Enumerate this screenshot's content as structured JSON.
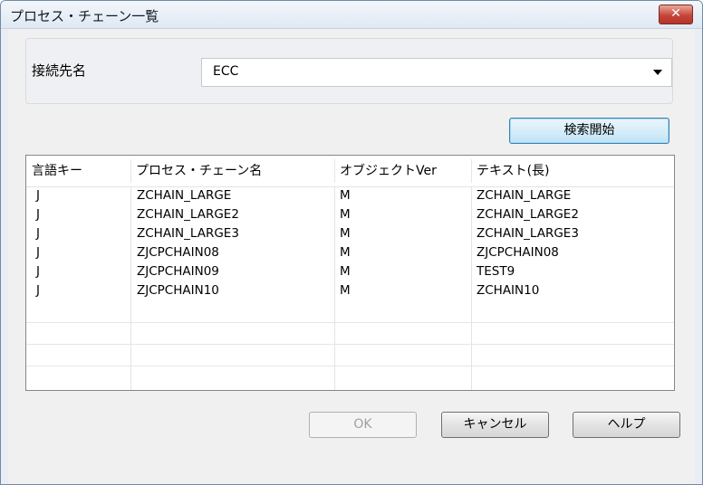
{
  "window": {
    "title": "プロセス・チェーン一覧",
    "close_label": "✕"
  },
  "connection": {
    "label": "接続先名",
    "value": "ECC"
  },
  "search_button": "検索開始",
  "table": {
    "columns": [
      "言語キー",
      "プロセス・チェーン名",
      "オブジェクトVer",
      "テキスト(長)"
    ],
    "rows": [
      [
        "J",
        "ZCHAIN_LARGE",
        "M",
        "ZCHAIN_LARGE"
      ],
      [
        "J",
        "ZCHAIN_LARGE2",
        "M",
        "ZCHAIN_LARGE2"
      ],
      [
        "J",
        "ZCHAIN_LARGE3",
        "M",
        "ZCHAIN_LARGE3"
      ],
      [
        "J",
        "ZJCPCHAIN08",
        "M",
        "ZJCPCHAIN08"
      ],
      [
        "J",
        "ZJCPCHAIN09",
        "M",
        "TEST9"
      ],
      [
        "J",
        "ZJCPCHAIN10",
        "M",
        "ZCHAIN10"
      ]
    ]
  },
  "buttons": {
    "ok": "OK",
    "cancel": "キャンセル",
    "help": "ヘルプ"
  }
}
